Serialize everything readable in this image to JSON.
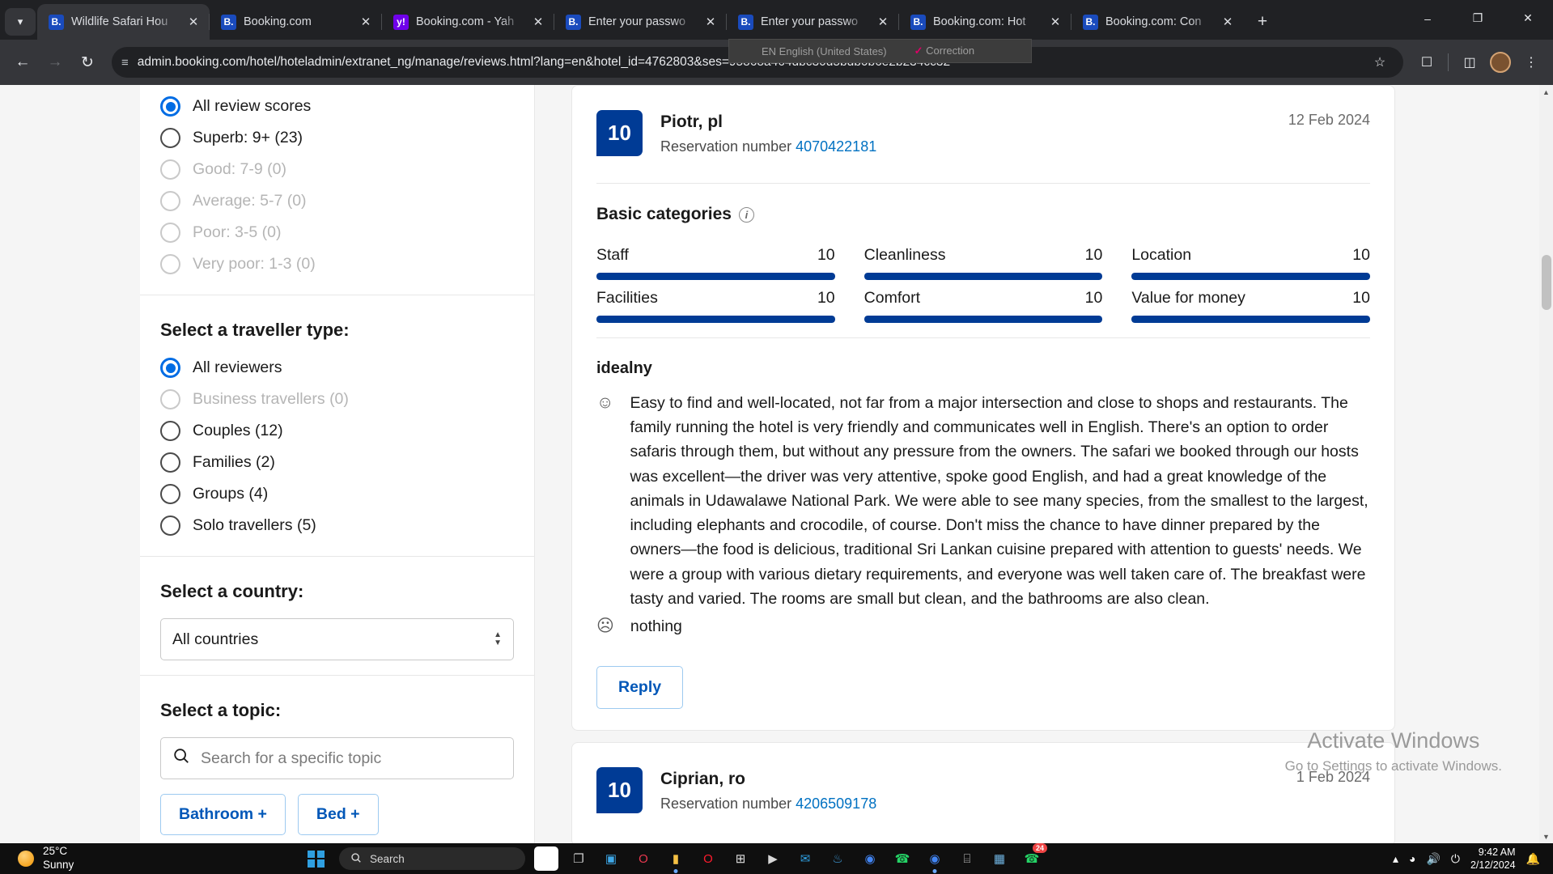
{
  "browser": {
    "tab_list_icon": "chevron-down-icon",
    "tabs": [
      {
        "favicon": "booking-favicon",
        "title": "Wildlife Safari Hou",
        "active": true
      },
      {
        "favicon": "booking-favicon",
        "title": "Booking.com",
        "active": false
      },
      {
        "favicon": "yahoo-favicon",
        "title": "Booking.com - Yah",
        "active": false
      },
      {
        "favicon": "booking-favicon",
        "title": "Enter your passwo",
        "active": false
      },
      {
        "favicon": "booking-favicon",
        "title": "Enter your passwo",
        "active": false
      },
      {
        "favicon": "booking-favicon",
        "title": "Booking.com: Hot",
        "active": false
      },
      {
        "favicon": "booking-favicon",
        "title": "Booking.com: Con",
        "active": false
      }
    ],
    "new_tab_label": "+",
    "window_controls": {
      "minimize": "–",
      "maximize": "❐",
      "close": "✕"
    },
    "nav": {
      "back": "←",
      "forward": "→",
      "reload": "↻"
    },
    "url": "admin.booking.com/hotel/hoteladmin/extranet_ng/manage/reviews.html?lang=en&hotel_id=4762803&ses=95868a464dbc30d5bdb0b6e2b234cc32",
    "site_info_icon": "page-settings-icon",
    "bookmark_icon": "star-icon",
    "extensions_icon": "puzzle-icon",
    "sidepanel_icon": "side-panel-icon",
    "menu_icon": "kebab-menu-icon",
    "language_bar": {
      "language": "EN English (United States)",
      "correction": "Correction"
    }
  },
  "sidebar": {
    "score_filter": {
      "options": [
        {
          "label": "All review scores",
          "selected": true,
          "disabled": false
        },
        {
          "label": "Superb: 9+ (23)",
          "selected": false,
          "disabled": false
        },
        {
          "label": "Good: 7-9 (0)",
          "selected": false,
          "disabled": true
        },
        {
          "label": "Average: 5-7 (0)",
          "selected": false,
          "disabled": true
        },
        {
          "label": "Poor: 3-5 (0)",
          "selected": false,
          "disabled": true
        },
        {
          "label": "Very poor: 1-3 (0)",
          "selected": false,
          "disabled": true
        }
      ]
    },
    "traveller_filter": {
      "title": "Select a traveller type:",
      "options": [
        {
          "label": "All reviewers",
          "selected": true,
          "disabled": false
        },
        {
          "label": "Business travellers (0)",
          "selected": false,
          "disabled": true
        },
        {
          "label": "Couples (12)",
          "selected": false,
          "disabled": false
        },
        {
          "label": "Families (2)",
          "selected": false,
          "disabled": false
        },
        {
          "label": "Groups (4)",
          "selected": false,
          "disabled": false
        },
        {
          "label": "Solo travellers (5)",
          "selected": false,
          "disabled": false
        }
      ]
    },
    "country_filter": {
      "title": "Select a country:",
      "value": "All countries"
    },
    "topic_filter": {
      "title": "Select a topic:",
      "placeholder": "Search for a specific topic",
      "search_icon": "search-icon",
      "chips": [
        "Bathroom +",
        "Bed +"
      ]
    }
  },
  "reviews": [
    {
      "score": "10",
      "name": "Piotr, pl",
      "reservation_label": "Reservation number",
      "reservation_number": "4070422181",
      "date": "12 Feb 2024",
      "categories_title": "Basic categories",
      "info_icon": "info-icon",
      "categories": [
        {
          "name": "Staff",
          "score": "10",
          "pct": 100
        },
        {
          "name": "Cleanliness",
          "score": "10",
          "pct": 100
        },
        {
          "name": "Location",
          "score": "10",
          "pct": 100
        },
        {
          "name": "Facilities",
          "score": "10",
          "pct": 100
        },
        {
          "name": "Comfort",
          "score": "10",
          "pct": 100
        },
        {
          "name": "Value for money",
          "score": "10",
          "pct": 100
        }
      ],
      "title": "idealny",
      "positive_icon": "smiley-happy-icon",
      "positive": "Easy to find and well-located, not far from a major intersection and close to shops and restaurants. The family running the hotel is very friendly and communicates well in English. There's an option to order safaris through them, but without any pressure from the owners. The safari we booked through our hosts was excellent—the driver was very attentive, spoke good English, and had a great knowledge of the animals in Udawalawe National Park. We were able to see many species, from the smallest to the largest, including elephants and crocodile, of course. Don't miss the chance to have dinner prepared by the owners—the food is delicious, traditional Sri Lankan cuisine prepared with attention to guests' needs. We were a group with various dietary requirements, and everyone was well taken care of. The breakfast were tasty and varied. The rooms are small but clean, and the bathrooms are also clean.",
      "negative_icon": "smiley-sad-icon",
      "negative": "nothing",
      "reply_label": "Reply"
    },
    {
      "score": "10",
      "name": "Ciprian, ro",
      "reservation_label": "Reservation number",
      "reservation_number": "4206509178",
      "date": "1 Feb 2024"
    }
  ],
  "watermark": {
    "line1": "Activate Windows",
    "line2": "Go to Settings to activate Windows."
  },
  "taskbar": {
    "weather": {
      "temp": "25°C",
      "condition": "Sunny",
      "icon": "sun-icon"
    },
    "start_icon": "windows-start-icon",
    "search": {
      "placeholder": "Search",
      "icon": "search-icon"
    },
    "apps": [
      {
        "name": "copilot-icon",
        "glyph": "◉",
        "color": "#ffffff",
        "bg": "#ffffff",
        "running": false,
        "badge": ""
      },
      {
        "name": "task-view-icon",
        "glyph": "❐",
        "color": "#cfcfcf",
        "bg": "transparent",
        "running": false,
        "badge": ""
      },
      {
        "name": "widgets-icon",
        "glyph": "▣",
        "color": "#3ea8e8",
        "bg": "transparent",
        "running": false,
        "badge": ""
      },
      {
        "name": "opera-icon",
        "glyph": "O",
        "color": "#e8384f",
        "bg": "transparent",
        "running": false,
        "badge": ""
      },
      {
        "name": "file-explorer-icon",
        "glyph": "▮",
        "color": "#f5c044",
        "bg": "transparent",
        "running": true,
        "badge": ""
      },
      {
        "name": "opera-gx-icon",
        "glyph": "O",
        "color": "#ff1b2d",
        "bg": "transparent",
        "running": false,
        "badge": ""
      },
      {
        "name": "microsoft-store-icon",
        "glyph": "⊞",
        "color": "#e0e0e0",
        "bg": "transparent",
        "running": false,
        "badge": ""
      },
      {
        "name": "media-player-icon",
        "glyph": "▶",
        "color": "#d8d8d8",
        "bg": "transparent",
        "running": false,
        "badge": ""
      },
      {
        "name": "mail-icon",
        "glyph": "✉",
        "color": "#2f9fe0",
        "bg": "transparent",
        "running": false,
        "badge": ""
      },
      {
        "name": "mega-icon",
        "glyph": "♨",
        "color": "#3f9ad6",
        "bg": "transparent",
        "running": false,
        "badge": ""
      },
      {
        "name": "chrome-icon",
        "glyph": "◉",
        "color": "#4285f4",
        "bg": "transparent",
        "running": false,
        "badge": ""
      },
      {
        "name": "whatsapp-icon",
        "glyph": "☎",
        "color": "#25d366",
        "bg": "transparent",
        "running": false,
        "badge": ""
      },
      {
        "name": "chrome-active-icon",
        "glyph": "◉",
        "color": "#4285f4",
        "bg": "transparent",
        "running": true,
        "badge": ""
      },
      {
        "name": "calculator-icon",
        "glyph": "⌸",
        "color": "#c8c8c8",
        "bg": "transparent",
        "running": false,
        "badge": ""
      },
      {
        "name": "excel-icon",
        "glyph": "▦",
        "color": "#6fb3e0",
        "bg": "transparent",
        "running": false,
        "badge": ""
      },
      {
        "name": "whatsapp-business-icon",
        "glyph": "☎",
        "color": "#25d366",
        "bg": "transparent",
        "running": false,
        "badge": "24"
      }
    ],
    "tray": {
      "chevron_icon": "chevron-up-icon",
      "wifi_icon": "wifi-icon",
      "volume_icon": "volume-icon",
      "battery_icon": "battery-icon",
      "time": "9:42 AM",
      "date": "2/12/2024",
      "notification_icon": "bell-icon"
    }
  }
}
